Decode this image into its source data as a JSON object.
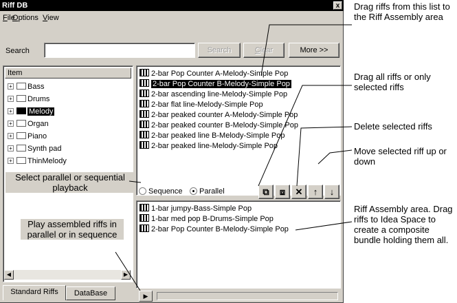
{
  "window": {
    "title": "Riff DB",
    "close_glyph": "x"
  },
  "menu": [
    {
      "accel": "F",
      "rest": "ile"
    },
    {
      "accel": "O",
      "rest": "ptions"
    },
    {
      "accel": "V",
      "rest": "iew"
    }
  ],
  "search": {
    "label": "Search",
    "value": "",
    "search_button": "Search",
    "clear_button_accel": "C",
    "clear_button_rest": "lear",
    "more_button": "More >>"
  },
  "tree": {
    "header": "Item",
    "items": [
      "Bass",
      "Drums",
      "Melody",
      "Organ",
      "Piano",
      "Synth pad",
      "ThinMelody"
    ],
    "selected": "Melody"
  },
  "tabs": [
    "Standard Riffs",
    "DataBase"
  ],
  "riffs": [
    "2-bar Pop Counter A-Melody-Simple Pop",
    "2-bar Pop Counter B-Melody-Simple Pop",
    "2-bar ascending line-Melody-Simple Pop",
    "2-bar flat line-Melody-Simple Pop",
    "2-bar peaked counter A-Melody-Simple Pop",
    "2-bar peaked counter B-Melody-Simple Pop",
    "2-bar peaked line B-Melody-Simple Pop",
    "2-bar peaked line-Melody-Simple Pop"
  ],
  "selected_riff": "2-bar Pop Counter B-Melody-Simple Pop",
  "playback": {
    "sequence_label": "Sequence",
    "parallel_label": "Parallel",
    "selected": "Parallel"
  },
  "assembly": [
    "1-bar jumpy-Bass-Simple Pop",
    "1-bar med pop B-Drums-Simple Pop",
    "2-bar Pop Counter B-Melody-Simple Pop"
  ],
  "annotations": {
    "drag_riffs": "Drag riffs from this list to the Riff Assembly area",
    "drag_all": "Drag all riffs or only selected riffs",
    "delete": "Delete selected riffs",
    "move": "Move selected riff up or down",
    "assembly": "Riff Assembly area. Drag  riffs to Idea Space to create a composite bundle holding them all.",
    "select_mode": "Select parallel or sequential playback",
    "play": "Play assembled riffs in  parallel or in sequence"
  },
  "icons": {
    "riff": "riff-icon",
    "folder": "folder-icon",
    "drag_all": "drag-all-icon",
    "drag_selected": "drag-selected-icon",
    "delete": "delete-icon",
    "up": "arrow-up-icon",
    "down": "arrow-down-icon",
    "play": "play-icon"
  }
}
